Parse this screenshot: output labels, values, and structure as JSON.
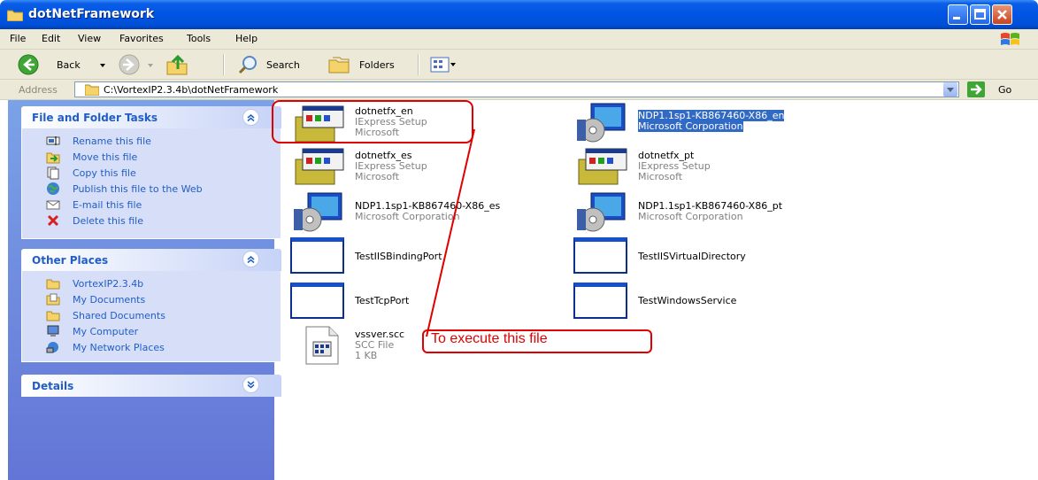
{
  "window": {
    "title": "dotNetFramework"
  },
  "menu": [
    "File",
    "Edit",
    "View",
    "Favorites",
    "Tools",
    "Help"
  ],
  "toolbar": {
    "back_label": "Back",
    "search_label": "Search",
    "folders_label": "Folders"
  },
  "address": {
    "label": "Address",
    "value": "C:\\VortexIP2.3.4b\\dotNetFramework",
    "go_label": "Go"
  },
  "panels": {
    "tasks": {
      "title": "File and Folder Tasks",
      "items": [
        {
          "label": "Rename this file",
          "icon": "rename-icon"
        },
        {
          "label": "Move this file",
          "icon": "move-icon"
        },
        {
          "label": "Copy this file",
          "icon": "copy-icon"
        },
        {
          "label": "Publish this file to the Web",
          "icon": "publish-web-icon"
        },
        {
          "label": "E-mail this file",
          "icon": "email-icon"
        },
        {
          "label": "Delete this file",
          "icon": "delete-icon"
        }
      ]
    },
    "places": {
      "title": "Other Places",
      "items": [
        {
          "label": "VortexIP2.3.4b",
          "icon": "folder-icon"
        },
        {
          "label": "My Documents",
          "icon": "my-documents-icon"
        },
        {
          "label": "Shared Documents",
          "icon": "folder-icon"
        },
        {
          "label": "My Computer",
          "icon": "my-computer-icon"
        },
        {
          "label": "My Network Places",
          "icon": "network-places-icon"
        }
      ]
    },
    "details": {
      "title": "Details"
    }
  },
  "files": [
    {
      "name": "dotnetfx_en",
      "line2": "IExpress Setup",
      "line3": "Microsoft",
      "icon": "installer-icon",
      "selected": false
    },
    {
      "name": "NDP1.1sp1-KB867460-X86_en",
      "line2": "Microsoft Corporation",
      "line3": "",
      "icon": "windows-installer-icon",
      "selected": true
    },
    {
      "name": "dotnetfx_es",
      "line2": "IExpress Setup",
      "line3": "Microsoft",
      "icon": "installer-icon",
      "selected": false
    },
    {
      "name": "dotnetfx_pt",
      "line2": "IExpress Setup",
      "line3": "Microsoft",
      "icon": "installer-icon",
      "selected": false
    },
    {
      "name": "NDP1.1sp1-KB867460-X86_es",
      "line2": "Microsoft Corporation",
      "line3": "",
      "icon": "windows-installer-icon",
      "selected": false
    },
    {
      "name": "NDP1.1sp1-KB867460-X86_pt",
      "line2": "Microsoft Corporation",
      "line3": "",
      "icon": "windows-installer-icon",
      "selected": false
    },
    {
      "name": "TestIISBindingPort",
      "line2": "",
      "line3": "",
      "icon": "application-window-icon",
      "selected": false
    },
    {
      "name": "TestIISVirtualDirectory",
      "line2": "",
      "line3": "",
      "icon": "application-window-icon",
      "selected": false
    },
    {
      "name": "TestTcpPort",
      "line2": "",
      "line3": "",
      "icon": "application-window-icon",
      "selected": false
    },
    {
      "name": "TestWindowsService",
      "line2": "",
      "line3": "",
      "icon": "application-window-icon",
      "selected": false
    },
    {
      "name": "vssver.scc",
      "line2": "SCC File",
      "line3": "1 KB",
      "icon": "scc-file-icon",
      "selected": false
    }
  ],
  "annotation": {
    "text": "To execute this file",
    "color": "#e00000"
  },
  "colors": {
    "titlebar": "#0054e3",
    "link": "#215dc6",
    "selection": "#316ac5",
    "annotation": "#e00000"
  }
}
